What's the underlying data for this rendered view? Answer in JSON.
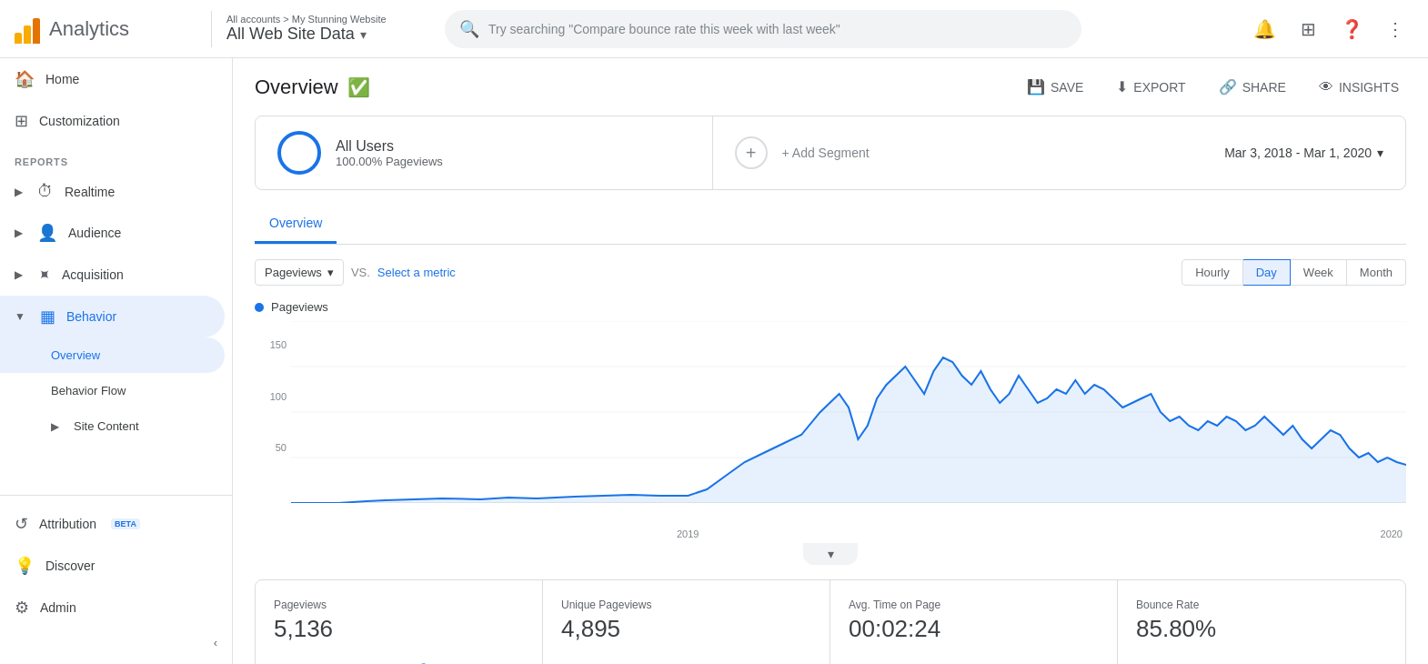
{
  "header": {
    "logo_title": "Analytics",
    "account_path": "All accounts > My Stunning Website",
    "account_name": "All Web Site Data",
    "search_placeholder": "Try searching \"Compare bounce rate this week with last week\"",
    "actions": [
      "notifications",
      "apps",
      "help",
      "more"
    ]
  },
  "sidebar": {
    "items": [
      {
        "id": "home",
        "label": "Home",
        "icon": "🏠",
        "type": "main"
      },
      {
        "id": "customization",
        "label": "Customization",
        "icon": "⊞",
        "type": "main"
      }
    ],
    "section_label": "REPORTS",
    "report_items": [
      {
        "id": "realtime",
        "label": "Realtime",
        "icon": "⏱",
        "type": "parent"
      },
      {
        "id": "audience",
        "label": "Audience",
        "icon": "👤",
        "type": "parent"
      },
      {
        "id": "acquisition",
        "label": "Acquisition",
        "icon": "↗",
        "type": "parent"
      },
      {
        "id": "behavior",
        "label": "Behavior",
        "icon": "▦",
        "type": "parent",
        "active": true
      },
      {
        "id": "behavior-overview",
        "label": "Overview",
        "type": "sub",
        "active": true
      },
      {
        "id": "behavior-flow",
        "label": "Behavior Flow",
        "type": "sub"
      },
      {
        "id": "site-content",
        "label": "Site Content",
        "type": "sub",
        "expandable": true
      }
    ],
    "bottom_items": [
      {
        "id": "attribution",
        "label": "Attribution",
        "icon": "↺",
        "beta": true
      },
      {
        "id": "discover",
        "label": "Discover",
        "icon": "💡"
      },
      {
        "id": "admin",
        "label": "Admin",
        "icon": "⚙"
      }
    ],
    "collapse_label": "<"
  },
  "page": {
    "title": "Overview",
    "verified": true,
    "actions": [
      {
        "id": "save",
        "label": "SAVE",
        "icon": "💾"
      },
      {
        "id": "export",
        "label": "EXPORT",
        "icon": "⬇"
      },
      {
        "id": "share",
        "label": "SHARE",
        "icon": "🔗"
      },
      {
        "id": "insights",
        "label": "INSIGHTS",
        "icon": "👁"
      }
    ]
  },
  "segments": [
    {
      "id": "all-users",
      "name": "All Users",
      "sub": "100.00% Pageviews",
      "color": "#1a73e8"
    },
    {
      "id": "add-segment",
      "name": "+ Add Segment",
      "type": "add"
    }
  ],
  "date_range": "Mar 3, 2018 - Mar 1, 2020",
  "tabs": [
    {
      "id": "overview",
      "label": "Overview",
      "active": true
    }
  ],
  "chart": {
    "metric_label": "Pageviews",
    "vs_label": "VS.",
    "select_metric_label": "Select a metric",
    "time_options": [
      {
        "id": "hourly",
        "label": "Hourly"
      },
      {
        "id": "day",
        "label": "Day",
        "active": true
      },
      {
        "id": "week",
        "label": "Week"
      },
      {
        "id": "month",
        "label": "Month"
      }
    ],
    "y_axis": [
      "150",
      "100",
      "50",
      ""
    ],
    "x_axis": [
      "2019",
      "2020"
    ],
    "legend": "Pageviews"
  },
  "stats": [
    {
      "id": "pageviews",
      "label": "Pageviews",
      "value": "5,136"
    },
    {
      "id": "unique-pageviews",
      "label": "Unique Pageviews",
      "value": "4,895"
    },
    {
      "id": "avg-time",
      "label": "Avg. Time on Page",
      "value": "00:02:24"
    },
    {
      "id": "bounce-rate",
      "label": "Bounce Rate",
      "value": "85.80%"
    }
  ]
}
